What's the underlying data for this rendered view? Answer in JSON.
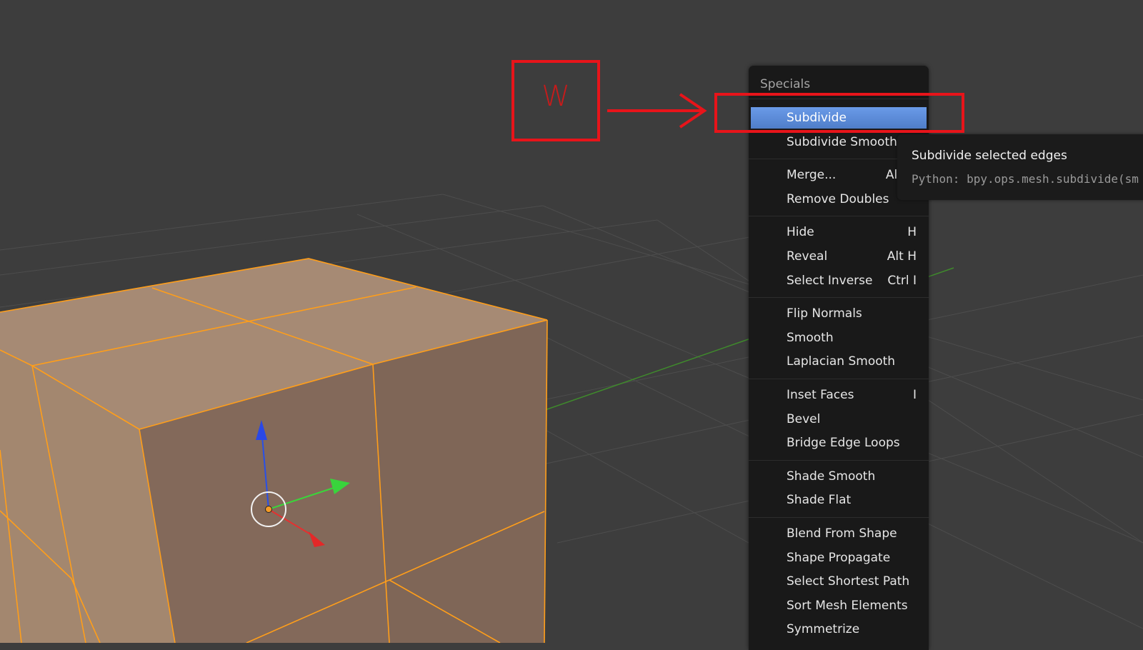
{
  "annotation": {
    "key": "W",
    "color": "#e8141a"
  },
  "menu": {
    "title": "Specials",
    "groups": [
      [
        {
          "label": "Subdivide",
          "shortcut": "",
          "active": true
        },
        {
          "label": "Subdivide Smooth",
          "shortcut": ""
        }
      ],
      [
        {
          "label": "Merge...",
          "shortcut": "Alt M"
        },
        {
          "label": "Remove Doubles",
          "shortcut": ""
        }
      ],
      [
        {
          "label": "Hide",
          "shortcut": "H"
        },
        {
          "label": "Reveal",
          "shortcut": "Alt H"
        },
        {
          "label": "Select Inverse",
          "shortcut": "Ctrl I"
        }
      ],
      [
        {
          "label": "Flip Normals",
          "shortcut": ""
        },
        {
          "label": "Smooth",
          "shortcut": ""
        },
        {
          "label": "Laplacian Smooth",
          "shortcut": ""
        }
      ],
      [
        {
          "label": "Inset Faces",
          "shortcut": "I"
        },
        {
          "label": "Bevel",
          "shortcut": ""
        },
        {
          "label": "Bridge Edge Loops",
          "shortcut": ""
        }
      ],
      [
        {
          "label": "Shade Smooth",
          "shortcut": ""
        },
        {
          "label": "Shade Flat",
          "shortcut": ""
        }
      ],
      [
        {
          "label": "Blend From Shape",
          "shortcut": ""
        },
        {
          "label": "Shape Propagate",
          "shortcut": ""
        },
        {
          "label": "Select Shortest Path",
          "shortcut": ""
        },
        {
          "label": "Sort Mesh Elements",
          "shortcut": ""
        },
        {
          "label": "Symmetrize",
          "shortcut": ""
        }
      ]
    ]
  },
  "tooltip": {
    "title": "Subdivide selected edges",
    "python": "Python: bpy.ops.mesh.subdivide(sm"
  },
  "colors": {
    "background": "#3d3d3d",
    "menu_bg": "#191919",
    "highlight": "#5b8bd9",
    "mesh_edge": "#ff9e1a",
    "face_top": "#a68a74",
    "face_front": "#83695a"
  }
}
